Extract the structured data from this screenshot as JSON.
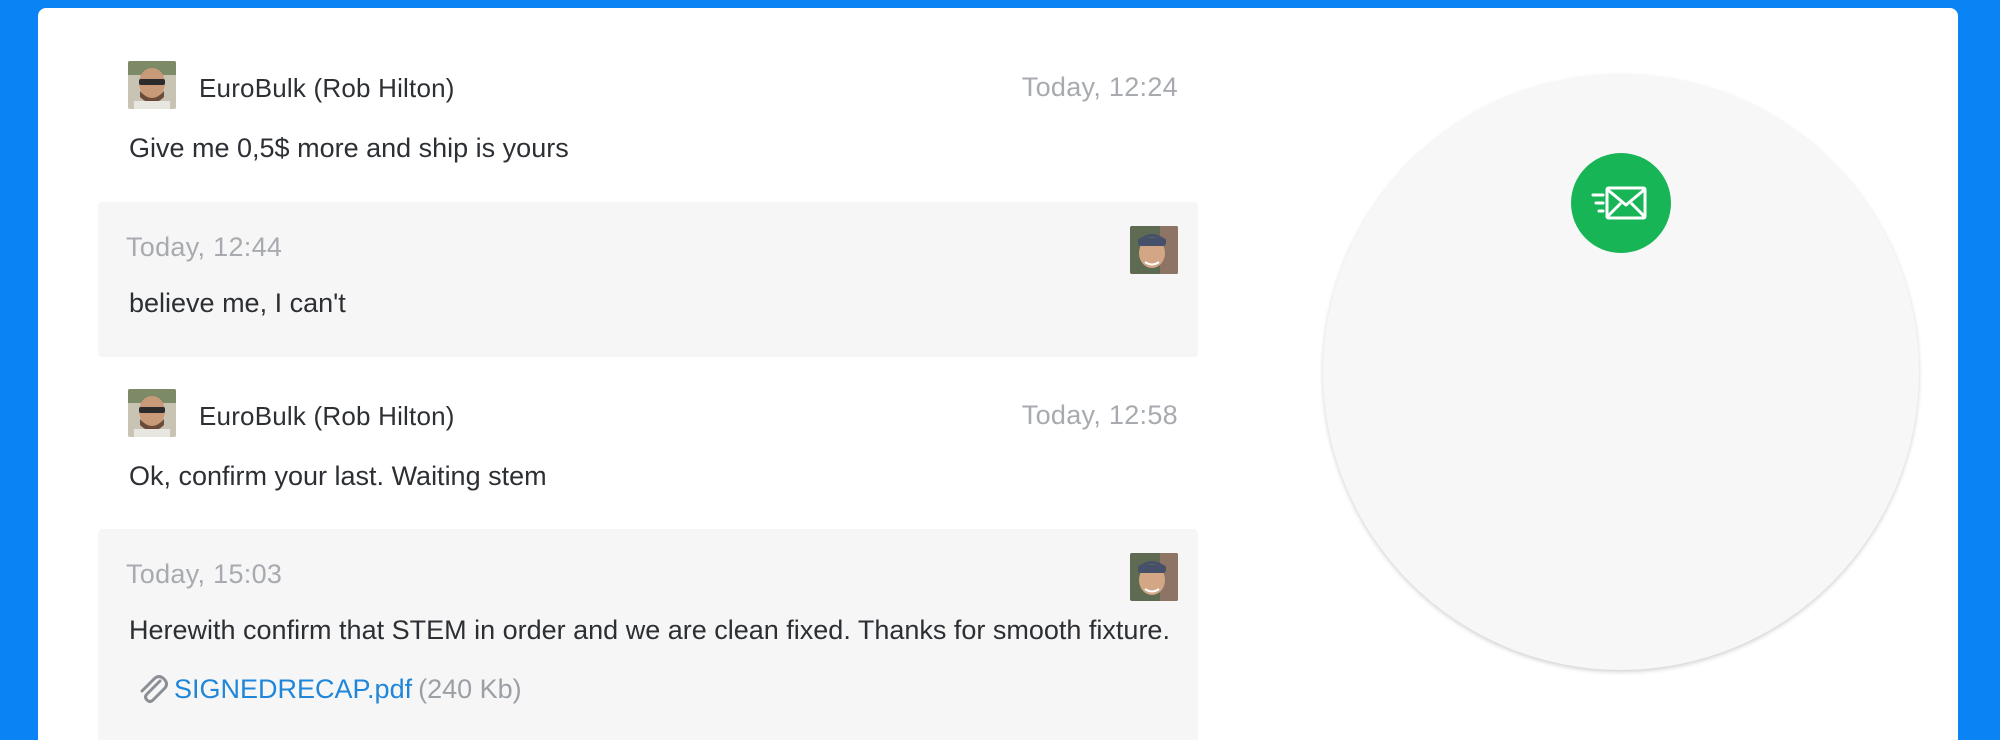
{
  "messages": [
    {
      "direction": "incoming",
      "sender": "EuroBulk (Rob Hilton)",
      "time": "Today, 12:24",
      "text": "Give me 0,5$ more and ship is yours"
    },
    {
      "direction": "outgoing",
      "time": "Today, 12:44",
      "text": "believe me, I can't"
    },
    {
      "direction": "incoming",
      "sender": "EuroBulk (Rob Hilton)",
      "time": "Today, 12:58",
      "text": "Ok, confirm your last. Waiting stem"
    },
    {
      "direction": "outgoing",
      "time": "Today, 15:03",
      "text": "Herewith confirm that STEM in order and we are clean fixed. Thanks for smooth fixture.",
      "attachment": {
        "name": "SIGNEDRECAP.pdf",
        "size": "(240 Kb)",
        "icon": "paperclip-icon"
      }
    }
  ],
  "compose": {
    "send_icon": "send-mail-icon",
    "accent": "#17b556"
  },
  "colors": {
    "page_background": "#0a84f4",
    "outgoing_bubble": "#f6f6f6",
    "timestamp": "#a7abb0",
    "link": "#1f86d9"
  }
}
